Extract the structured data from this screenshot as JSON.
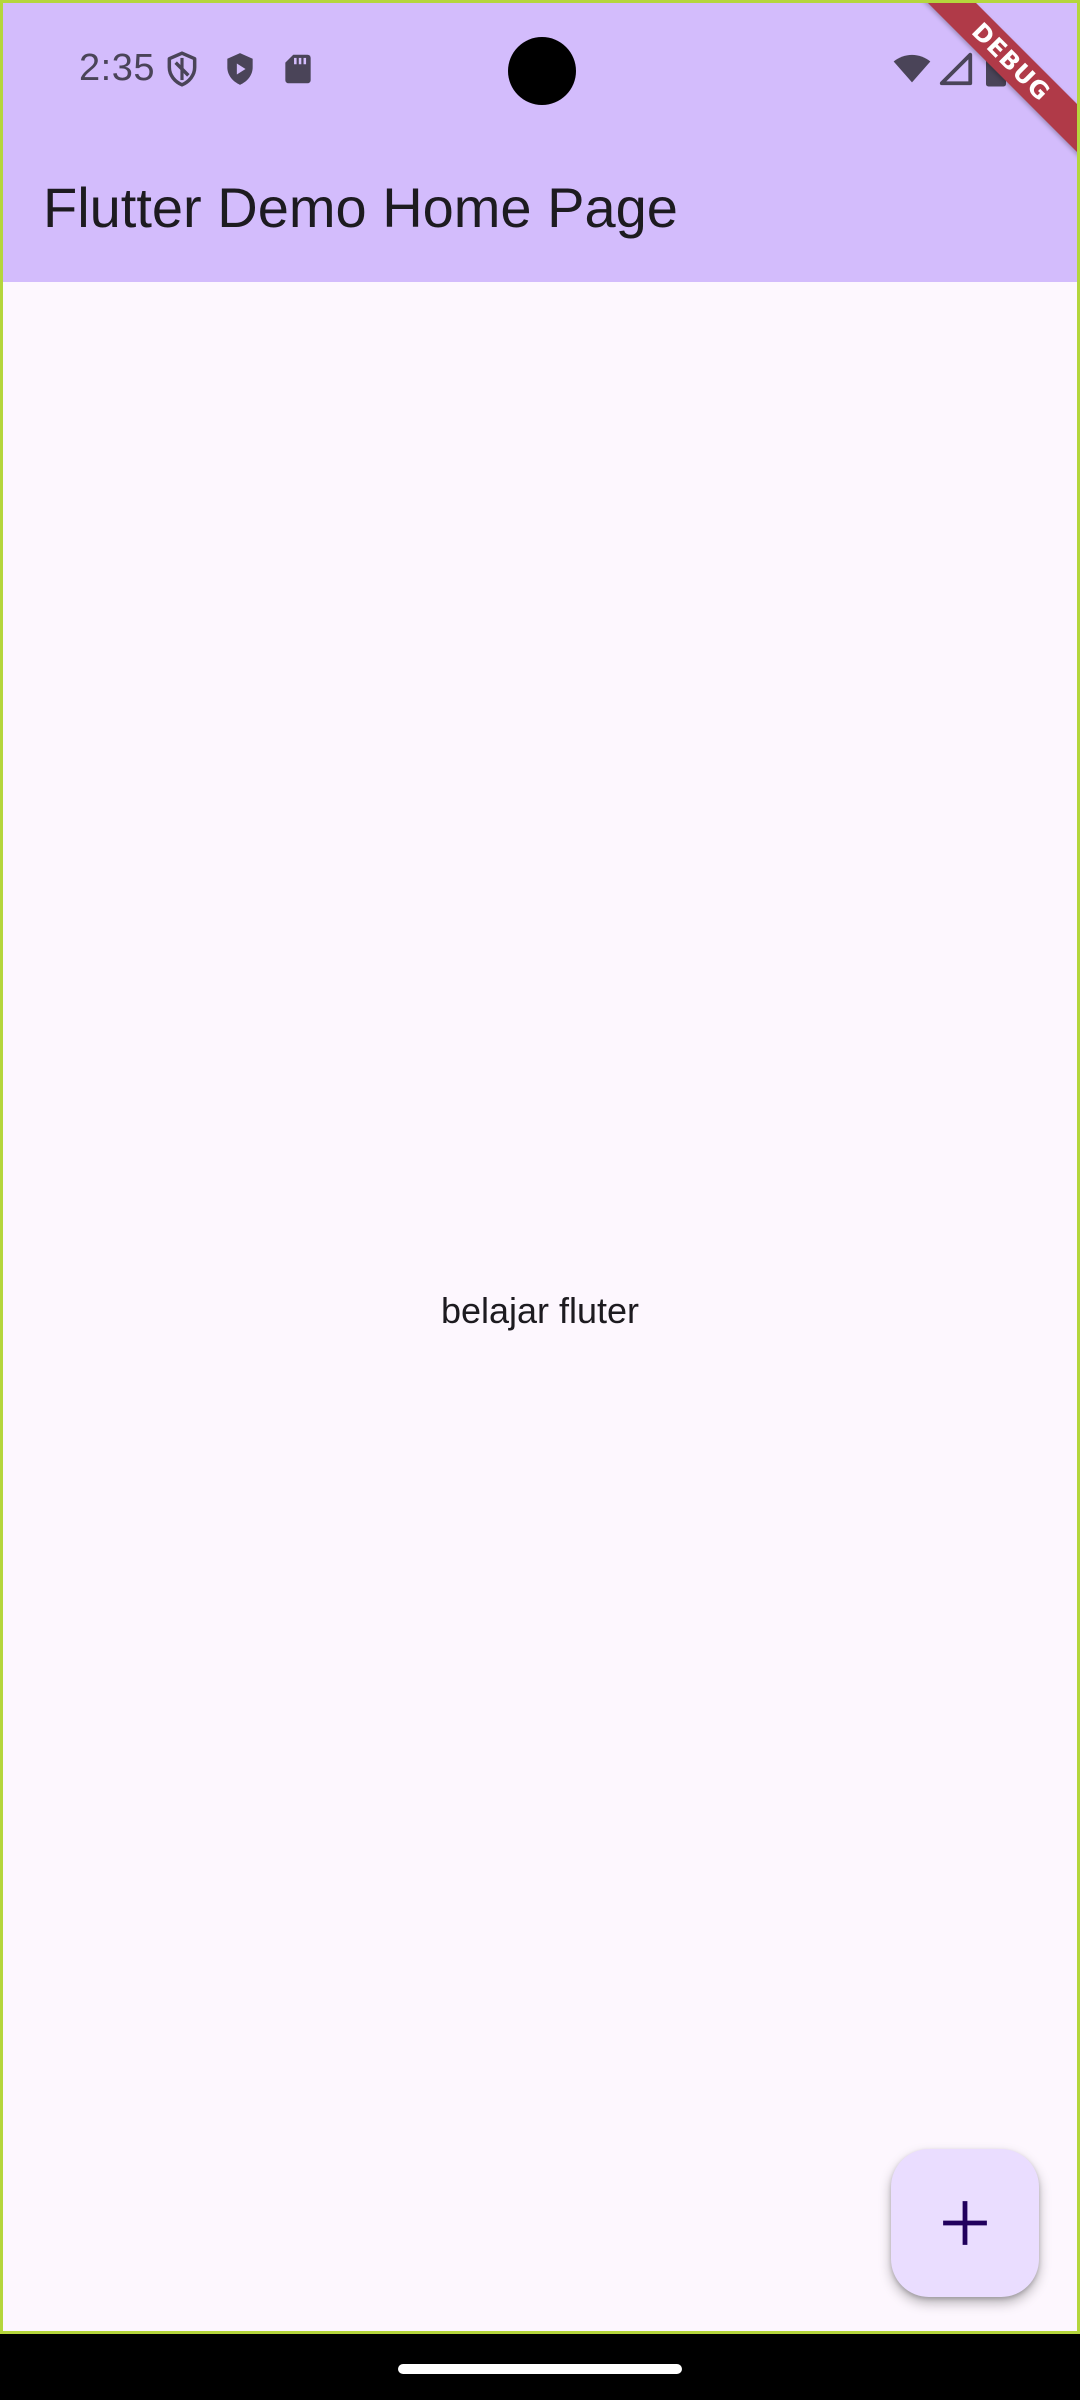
{
  "status_bar": {
    "time": "2:35",
    "left_icons": [
      "shield-outline-icon",
      "shield-play-icon",
      "sd-card-icon"
    ],
    "right_icons": [
      "wifi-icon",
      "cellular-signal-icon",
      "battery-icon"
    ]
  },
  "app_bar": {
    "title": "Flutter Demo Home Page",
    "background_color": "#d3bcfc"
  },
  "debug_banner": {
    "label": "DEBUG",
    "color": "#b03a48"
  },
  "body": {
    "text": "belajar fluter",
    "background_color": "#fdf7fe"
  },
  "fab": {
    "icon": "add-icon",
    "background_color": "#eaddff"
  }
}
